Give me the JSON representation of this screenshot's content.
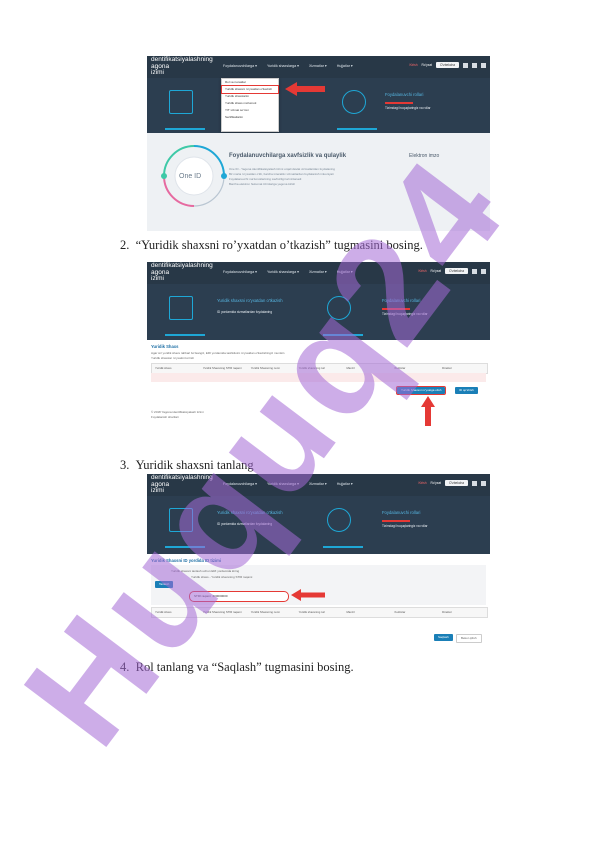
{
  "shot1": {
    "brand": [
      "dentifikatsiyalashning",
      "agona",
      "izimi"
    ],
    "menus": [
      "Foydalanuvchilarga ▾",
      "Yuridik shaxslarga ▾",
      "Xizmatlar ▾",
      "Hujjatlar ▾"
    ],
    "topright": {
      "red": "Kirish",
      "mid": "Ro'yxat",
      "select": "O'zbekcha"
    },
    "dropdown": [
      "Rol va ruxsatlar",
      "Yuridik shaxsni ro'yxatdan o'tkazish",
      "Yuridik shaxslarim",
      "Yuridik shaxs ma'lumoti",
      "YIT xizmat so'rovi",
      "Sertifikatlarim"
    ],
    "card_right_title": "Foydalanuvchi rollari",
    "card_right_sub": "Tizimdagi huquqlaringiz va rollar",
    "onid_label": "One ID",
    "main_title": "Foydalanuvchilarga xavfsizlik va qulaylik",
    "main_lines": [
      "One ID - Yagona identifikatsiyalash tizimi orqali davlat xizmatlaridan foydalaning",
      "Bir marta ro'yxatdan o'tib, barcha interaktiv xizmatlardan foydalanish imkoniyati",
      "Foydalanuvchi ma'lumotlarining xavfsizligi ta'minlanadi",
      "Barcha elektron hukumat tizimlariga yagona kirish"
    ],
    "side_title": "Elektron imzo"
  },
  "step2": {
    "num": "2.",
    "text": "“Yuridik shaxsni ro’yxatdan o’tkazish” tugmasini bosing."
  },
  "shot2": {
    "brand": [
      "dentifikatsiyalashning",
      "agona",
      "izimi"
    ],
    "menus": [
      "Foydalanuvchilarga ▾",
      "Yuridik shaxslarga ▾",
      "Xizmatlar ▾",
      "Hujjatlar ▾"
    ],
    "topright": {
      "red": "Kirish",
      "mid": "Ro'yxat",
      "select": "O'zbekcha"
    },
    "card_left_title": "Yuridik shaxsni ro'yxatdan o'tkazish",
    "card_left_sub": "ID yordamida xizmatlardan foydalaning",
    "card_right_title": "Foydalanuvchi rollari",
    "card_right_sub": "Tizimdagi huquqlaringiz va rollar",
    "panel_title": "Yuridik Shaxs",
    "panel_lines": [
      "Agar siz yuridik shaxs rahbari bo'lsangiz, ERI yordamida tashkilotni ro'yxatdan o'tkazishingiz mumkin",
      "Yuridik shaxslar ro'yxatini ko'rish"
    ],
    "columns": [
      "Yuridik shaxs",
      "Yuridik Shaxsning STIR raqami",
      "Yuridik Shaxsning nomi",
      "Yuridik shaxsning turi",
      "Manzil",
      "Xodimlar",
      "Direktor"
    ],
    "btn_primary": "Yuridik Shaxsni ro'yxatga olish",
    "btn_secondary": "ID qo'shish",
    "footer_lines": [
      "© 2018 Yagona identifikatsiyalash tizimi",
      "Foydalanish shartlari"
    ]
  },
  "step3": {
    "num": "3.",
    "text": "Yuridik shaxsni tanlang"
  },
  "shot3": {
    "brand": [
      "dentifikatsiyalashning",
      "agona",
      "izimi"
    ],
    "menus": [
      "Foydalanuvchilarga ▾",
      "Yuridik shaxslarga ▾",
      "Xizmatlar ▾",
      "Hujjatlar ▾"
    ],
    "topright": {
      "red": "Kirish",
      "mid": "Ro'yxat",
      "select": "O'zbekcha"
    },
    "card_left_title": "Yuridik shaxsni ro'yxatdan o'tkazish",
    "card_left_sub": "ID yordamida xizmatlardan foydalaning",
    "card_right_title": "Foydalanuvchi rollari",
    "card_right_sub": "Tizimdagi huquqlaringiz va rollar",
    "panel_title": "Yuridik Shaxsni ID yordida ID tizimi",
    "form_lines": [
      "Yuridik shaxsni tanlash uchun ERI yordamida kiring",
      "Yuridik shaxs - Yuridik shaxsning STIR raqami"
    ],
    "form_button": "Tanlash",
    "stir_label": "STIR raqami",
    "stir_value": "200000000",
    "columns": [
      "Yuridik shaxs",
      "Yuridik Shaxsning STIR raqami",
      "Yuridik Shaxsning nomi",
      "Yuridik shaxsning turi",
      "Manzil",
      "Xodimlar",
      "Direktor"
    ],
    "btn_primary": "Saqlash",
    "btn_secondary": "Bekor qilish"
  },
  "step4": {
    "num": "4.",
    "text": "Rol tanlang va “Saqlash” tugmasini bosing."
  },
  "watermark": "Huquq24",
  "colors": {
    "accent": "#1ea7d6",
    "dark": "#2c3e50",
    "red": "#e53935",
    "watermark": "#a46ad6"
  }
}
